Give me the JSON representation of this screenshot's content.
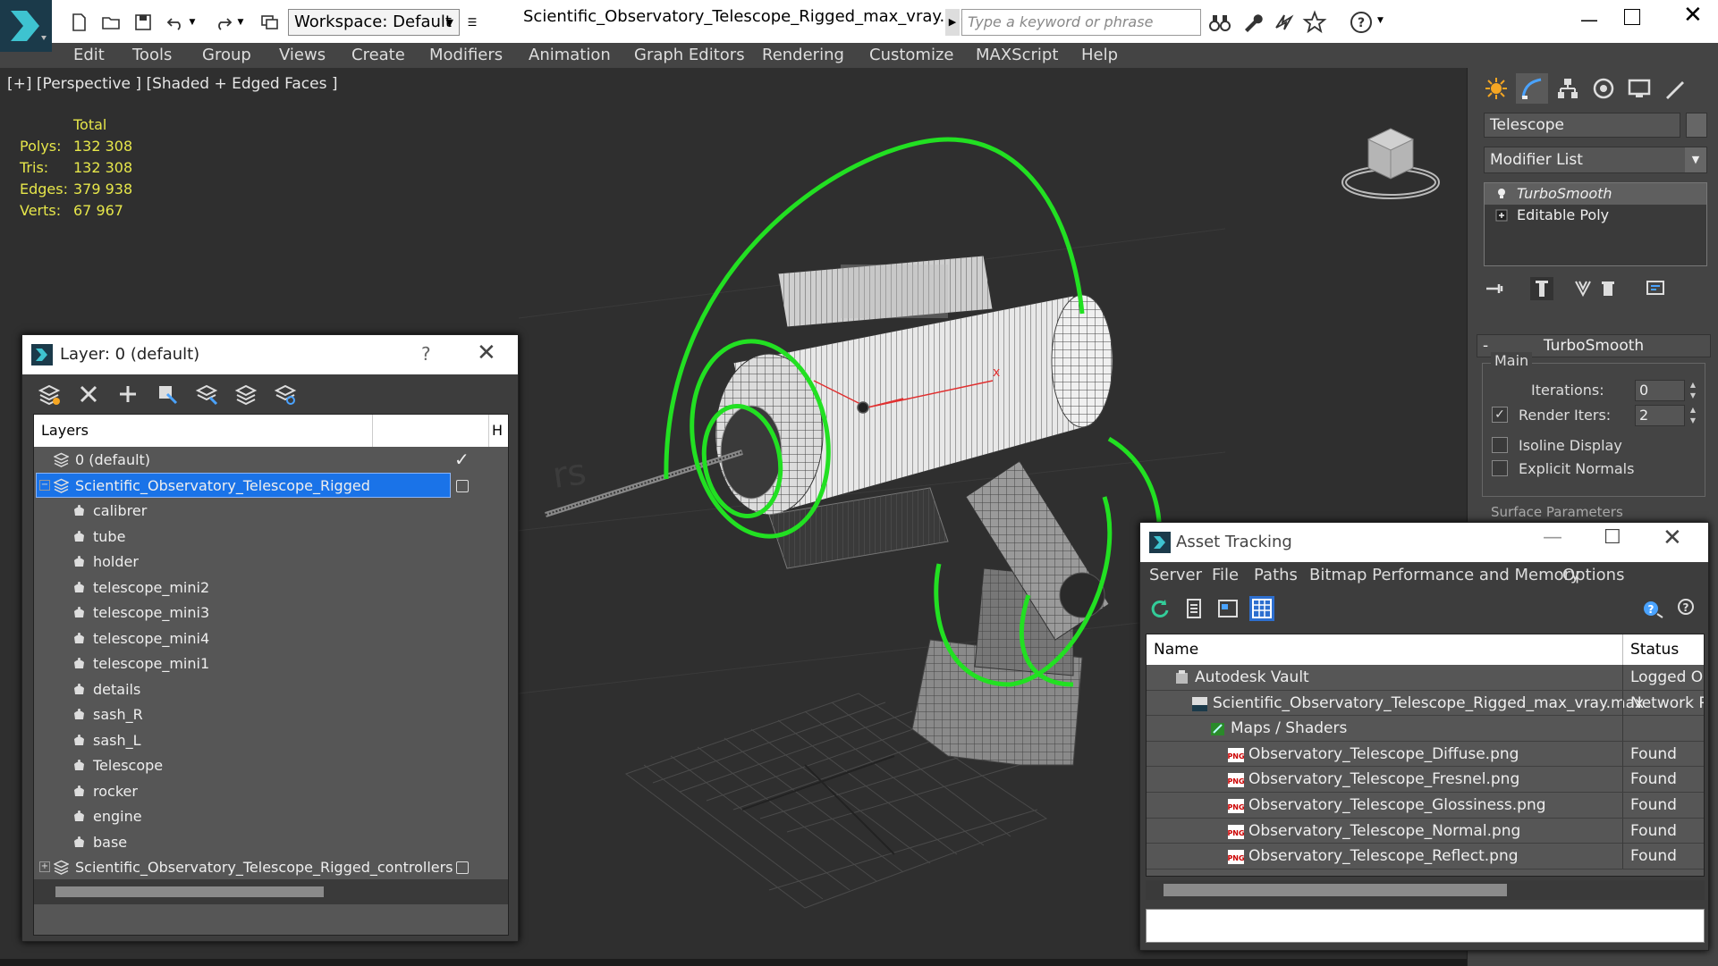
{
  "app": {
    "file_title": "Scientific_Observatory_Telescope_Rigged_max_vray.max",
    "workspace": "Workspace: Default",
    "search_placeholder": "Type a keyword or phrase"
  },
  "menu": [
    "Edit",
    "Tools",
    "Group",
    "Views",
    "Create",
    "Modifiers",
    "Animation",
    "Graph Editors",
    "Rendering",
    "Customize",
    "MAXScript",
    "Help"
  ],
  "viewport": {
    "label": "[+] [Perspective ] [Shaded + Edged Faces ]",
    "stats": {
      "header": "Total",
      "rows": [
        {
          "label": "Polys:",
          "value": "132 308"
        },
        {
          "label": "Tris:",
          "value": "132 308"
        },
        {
          "label": "Edges:",
          "value": "379 938"
        },
        {
          "label": "Verts:",
          "value": "67 967"
        }
      ]
    },
    "watermark": "rs"
  },
  "command_panel": {
    "object_name": "Telescope",
    "modifier_list": "Modifier List",
    "stack": [
      "TurboSmooth",
      "Editable Poly"
    ],
    "rollout_title": "TurboSmooth",
    "group_main": "Main",
    "iterations_label": "Iterations:",
    "iterations_value": "0",
    "render_iters_label": "Render Iters:",
    "render_iters_value": "2",
    "isoline_label": "Isoline Display",
    "explicit_normals_label": "Explicit Normals",
    "surface_params": "Surface Parameters"
  },
  "layer_explorer": {
    "title": "Layer: 0 (default)",
    "help": "?",
    "col_layers": "Layers",
    "col_hide": "H",
    "rows": [
      {
        "name": "0 (default)",
        "kind": "layer",
        "level": 0
      },
      {
        "name": "Scientific_Observatory_Telescope_Rigged",
        "kind": "layer",
        "level": 0,
        "selected": true,
        "expander": "−"
      },
      {
        "name": "calibrer",
        "kind": "object",
        "level": 1
      },
      {
        "name": "tube",
        "kind": "object",
        "level": 1
      },
      {
        "name": "holder",
        "kind": "object",
        "level": 1
      },
      {
        "name": "telescope_mini2",
        "kind": "object",
        "level": 1
      },
      {
        "name": "telescope_mini3",
        "kind": "object",
        "level": 1
      },
      {
        "name": "telescope_mini4",
        "kind": "object",
        "level": 1
      },
      {
        "name": "telescope_mini1",
        "kind": "object",
        "level": 1
      },
      {
        "name": "details",
        "kind": "object",
        "level": 1
      },
      {
        "name": "sash_R",
        "kind": "object",
        "level": 1
      },
      {
        "name": "sash_L",
        "kind": "object",
        "level": 1
      },
      {
        "name": "Telescope",
        "kind": "object",
        "level": 1
      },
      {
        "name": "rocker",
        "kind": "object",
        "level": 1
      },
      {
        "name": "engine",
        "kind": "object",
        "level": 1
      },
      {
        "name": "base",
        "kind": "object",
        "level": 1
      },
      {
        "name": "Scientific_Observatory_Telescope_Rigged_controllers",
        "kind": "layer",
        "level": 0,
        "expander": "+"
      }
    ]
  },
  "asset_tracking": {
    "title": "Asset Tracking",
    "menu": [
      "Server",
      "File",
      "Paths",
      "Bitmap Performance and Memory",
      "Options"
    ],
    "col_name": "Name",
    "col_status": "Status",
    "rows": [
      {
        "name": "Autodesk Vault",
        "status": "Logged Out",
        "level": 1,
        "icon": "vault"
      },
      {
        "name": "Scientific_Observatory_Telescope_Rigged_max_vray.max",
        "status": "Network Path",
        "level": 2,
        "icon": "max"
      },
      {
        "name": "Maps / Shaders",
        "status": "",
        "level": 3,
        "icon": "maps"
      },
      {
        "name": "Observatory_Telescope_Diffuse.png",
        "status": "Found",
        "level": 4,
        "icon": "png"
      },
      {
        "name": "Observatory_Telescope_Fresnel.png",
        "status": "Found",
        "level": 4,
        "icon": "png"
      },
      {
        "name": "Observatory_Telescope_Glossiness.png",
        "status": "Found",
        "level": 4,
        "icon": "png"
      },
      {
        "name": "Observatory_Telescope_Normal.png",
        "status": "Found",
        "level": 4,
        "icon": "png"
      },
      {
        "name": "Observatory_Telescope_Reflect.png",
        "status": "Found",
        "level": 4,
        "icon": "png"
      }
    ]
  },
  "colors": {
    "stats_yellow": "#e6e64a",
    "selection_blue": "#1a73e8",
    "rig_green": "#22e022",
    "gizmo_red": "#e03030"
  }
}
